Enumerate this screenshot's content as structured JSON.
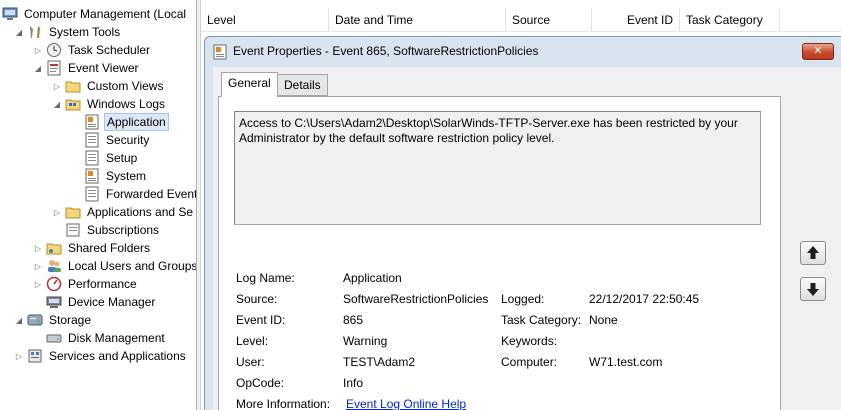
{
  "tree": {
    "root": "Computer Management (Local",
    "system_tools": "System Tools",
    "task_scheduler": "Task Scheduler",
    "event_viewer": "Event Viewer",
    "custom_views": "Custom Views",
    "windows_logs": "Windows Logs",
    "application": "Application",
    "security": "Security",
    "setup": "Setup",
    "system": "System",
    "forwarded_events": "Forwarded Event",
    "apps_services_logs": "Applications and Se",
    "subscriptions": "Subscriptions",
    "shared_folders": "Shared Folders",
    "local_users_groups": "Local Users and Groups",
    "performance": "Performance",
    "device_manager": "Device Manager",
    "storage": "Storage",
    "disk_management": "Disk Management",
    "services_apps": "Services and Applications"
  },
  "list_header": {
    "level": "Level",
    "date_time": "Date and Time",
    "source": "Source",
    "event_id": "Event ID",
    "task_category": "Task Category"
  },
  "dialog": {
    "title": "Event Properties - Event 865, SoftwareRestrictionPolicies",
    "close_glyph": "✕",
    "tabs": {
      "general": "General",
      "details": "Details"
    },
    "message": "Access to C:\\Users\\Adam2\\Desktop\\SolarWinds-TFTP-Server.exe has been restricted by your Administrator by the default software restriction policy level.",
    "fields": {
      "log_name_label": "Log Name:",
      "log_name_value": "Application",
      "source_label": "Source:",
      "source_value": "SoftwareRestrictionPolicies",
      "logged_label": "Logged:",
      "logged_value": "22/12/2017 22:50:45",
      "event_id_label": "Event ID:",
      "event_id_value": "865",
      "task_category_label": "Task Category:",
      "task_category_value": "None",
      "level_label": "Level:",
      "level_value": "Warning",
      "keywords_label": "Keywords:",
      "keywords_value": "",
      "user_label": "User:",
      "user_value": "TEST\\Adam2",
      "computer_label": "Computer:",
      "computer_value": "W71.test.com",
      "opcode_label": "OpCode:",
      "opcode_value": "Info",
      "more_info_label": "More Information:",
      "more_info_link": "Event Log Online Help"
    }
  },
  "colors": {
    "accent": "#dde8f6",
    "dialog_frame": "#d9e4f1",
    "link": "#0026d6",
    "close_button": "#c94b2c"
  }
}
